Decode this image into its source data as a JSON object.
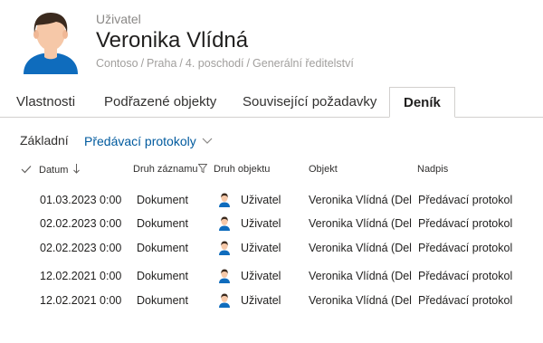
{
  "header": {
    "type_label": "Uživatel",
    "name": "Veronika Vlídná",
    "breadcrumb": [
      "Contoso",
      "Praha",
      "4. poschodí",
      "Generální ředitelství"
    ],
    "breadcrumb_separator": "/"
  },
  "tabs": [
    {
      "label": "Vlastnosti",
      "active": false
    },
    {
      "label": "Podřazené objekty",
      "active": false
    },
    {
      "label": "Související požadavky",
      "active": false
    },
    {
      "label": "Deník",
      "active": true
    }
  ],
  "subtabs": [
    {
      "label": "Základní",
      "active": false
    },
    {
      "label": "Předávací protokoly",
      "active": true
    }
  ],
  "grid": {
    "columns": {
      "date": "Datum",
      "record_type": "Druh záznamu",
      "object_type": "Druh objektu",
      "object": "Objekt",
      "title": "Nadpis"
    },
    "rows": [
      {
        "date": "01.03.2023 0:00",
        "record_type": "Dokument",
        "object_type": "Uživatel",
        "object": "Veronika Vlídná (Del",
        "title": "Předávací protokol"
      },
      {
        "date": "02.02.2023 0:00",
        "record_type": "Dokument",
        "object_type": "Uživatel",
        "object": "Veronika Vlídná (Del",
        "title": "Předávací protokol"
      },
      {
        "date": "02.02.2023 0:00",
        "record_type": "Dokument",
        "object_type": "Uživatel",
        "object": "Veronika Vlídná (Del",
        "title": "Předávací protokol"
      },
      {
        "date": "12.02.2021 0:00",
        "record_type": "Dokument",
        "object_type": "Uživatel",
        "object": "Veronika Vlídná (Del",
        "title": "Předávací protokol"
      },
      {
        "date": "12.02.2021 0:00",
        "record_type": "Dokument",
        "object_type": "Uživatel",
        "object": "Veronika Vlídná (Del",
        "title": "Předávací protokol"
      }
    ]
  },
  "icons": {
    "avatar": "user-avatar",
    "row_object": "user-icon",
    "select_all": "checkmark-icon",
    "sort": "arrow-down-icon",
    "filter": "filter-icon",
    "subtab_dropdown": "chevron-down-icon"
  },
  "colors": {
    "accent": "#005a9e",
    "avatar_shirt": "#0f6cbd",
    "avatar_skin": "#f6c8a8",
    "avatar_hair": "#3b2a1e",
    "muted_text": "#a19f9d"
  }
}
